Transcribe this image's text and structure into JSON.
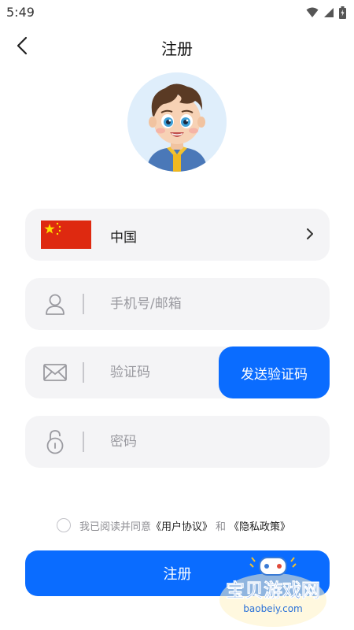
{
  "status_bar": {
    "time": "5:49"
  },
  "nav": {
    "title": "注册"
  },
  "region": {
    "value": "中国"
  },
  "phone": {
    "placeholder": "手机号/邮箱",
    "value": ""
  },
  "code": {
    "placeholder": "验证码",
    "value": "",
    "send_label": "发送验证码"
  },
  "password": {
    "placeholder": "密码",
    "value": ""
  },
  "agreement": {
    "checked": false,
    "prefix": "我已阅读并同意",
    "user_agreement": "《用户协议》",
    "and": "和",
    "privacy_policy": "《隐私政策》"
  },
  "submit": {
    "label": "注册"
  },
  "watermark": {
    "text": "宝贝游戏网",
    "domain": "baobeiy.com"
  },
  "colors": {
    "primary": "#0a6cff",
    "field_bg": "#f4f4f6",
    "avatar_bg": "#dfeefb"
  }
}
